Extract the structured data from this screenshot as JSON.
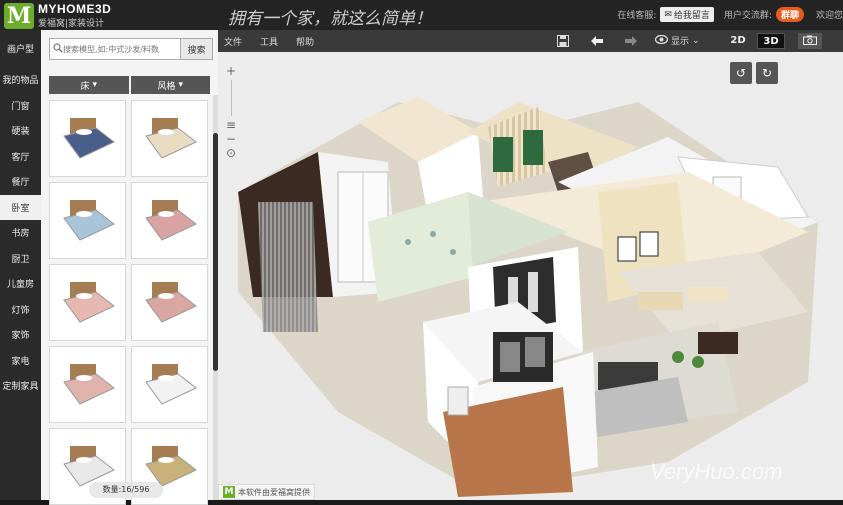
{
  "app": {
    "logo_letter": "M",
    "logo_name": "MYHOME3D",
    "logo_sub": "爱福窝|家装设计",
    "slogan": "拥有一个家，就这么简单！"
  },
  "topbar": {
    "service_label": "在线客服:",
    "message_button": "给我留言",
    "group_label": "用户交流群:",
    "qq_button": "群聊",
    "welcome": "欢迎您"
  },
  "menu": [
    "文件",
    "工具",
    "帮助"
  ],
  "toolbar": {
    "display_label": "显示",
    "view_2d": "2D",
    "view_3d": "3D",
    "active_view": "3D"
  },
  "categories": [
    "画户型",
    "我的物品",
    "门窗",
    "硬装",
    "客厅",
    "餐厅",
    "卧室",
    "书房",
    "厨卫",
    "儿童房",
    "灯饰",
    "家饰",
    "家电",
    "定制家具"
  ],
  "active_category": "卧室",
  "search": {
    "placeholder": "搜索模型,如:中式沙发/料数",
    "button": "搜索"
  },
  "filters": [
    {
      "label": "床"
    },
    {
      "label": "风格"
    }
  ],
  "products": [
    {
      "name": "bed-blue-plaid",
      "color": "#4a5e8a"
    },
    {
      "name": "bed-cream",
      "color": "#e8dcc2"
    },
    {
      "name": "bed-light-blue",
      "color": "#a8c4d8"
    },
    {
      "name": "bed-pink-floral",
      "color": "#d9a3a3"
    },
    {
      "name": "bed-pink-ornate",
      "color": "#e6b8b0"
    },
    {
      "name": "bed-pink-ornate-2",
      "color": "#d8a8a0"
    },
    {
      "name": "bed-pink-carved",
      "color": "#e0b3ac"
    },
    {
      "name": "bed-white-modern",
      "color": "#f2f2f2"
    },
    {
      "name": "bed-white-simple",
      "color": "#e8e8e8"
    },
    {
      "name": "bunk-bed",
      "color": "#c9b27a"
    }
  ],
  "item_count": "数量:16/596",
  "footer_note": "本软件由爱福窝提供",
  "watermark": "VeryHuo.com",
  "colors": {
    "brand_green": "#6cae2c",
    "qq_orange": "#e85a1e",
    "dark_bar": "#242424",
    "wall_cream": "#f3ead7",
    "floor_wood": "#b8754a"
  }
}
